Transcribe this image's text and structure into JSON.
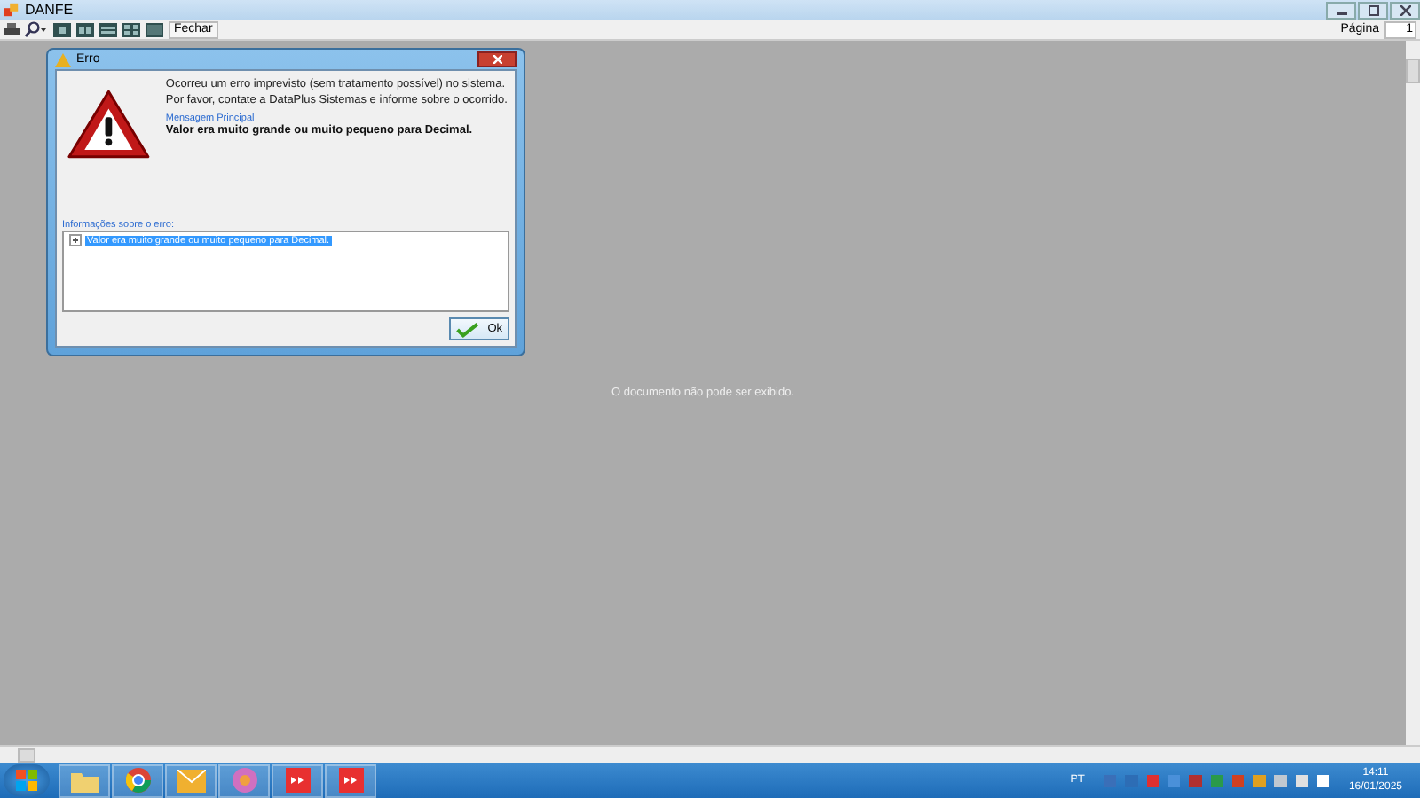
{
  "window": {
    "title": "DANFE"
  },
  "toolbar": {
    "tools": [
      {
        "kind": "print"
      },
      {
        "kind": "zoom"
      },
      {
        "kind": "single"
      },
      {
        "kind": "double"
      },
      {
        "kind": "rows"
      },
      {
        "kind": "grid"
      },
      {
        "kind": "multi"
      }
    ],
    "close_label": "Fechar",
    "page_label": "Página",
    "page_value": "1"
  },
  "viewer": {
    "message": "O documento não pode ser exibido."
  },
  "dialog": {
    "title": "Erro",
    "message": "Ocorreu um erro imprevisto (sem tratamento possível) no sistema. Por favor, contate a DataPlus Sistemas e informe sobre o ocorrido.",
    "section_label": "Mensagem Principal",
    "main_message": "Valor era muito grande ou muito pequeno para Decimal.",
    "details_label": "Informações sobre o erro:",
    "tree": [
      {
        "label": "Valor era muito grande ou muito pequeno para Decimal.",
        "expanded": false,
        "selected": true
      }
    ],
    "ok_label": "Ok"
  },
  "taskbar": {
    "apps": [
      {
        "kind": "folder"
      },
      {
        "kind": "browser"
      },
      {
        "kind": "mail"
      },
      {
        "kind": "media"
      },
      {
        "kind": "red"
      },
      {
        "kind": "red"
      }
    ],
    "language": "PT",
    "time": "14:11",
    "date": "16/01/2025"
  }
}
